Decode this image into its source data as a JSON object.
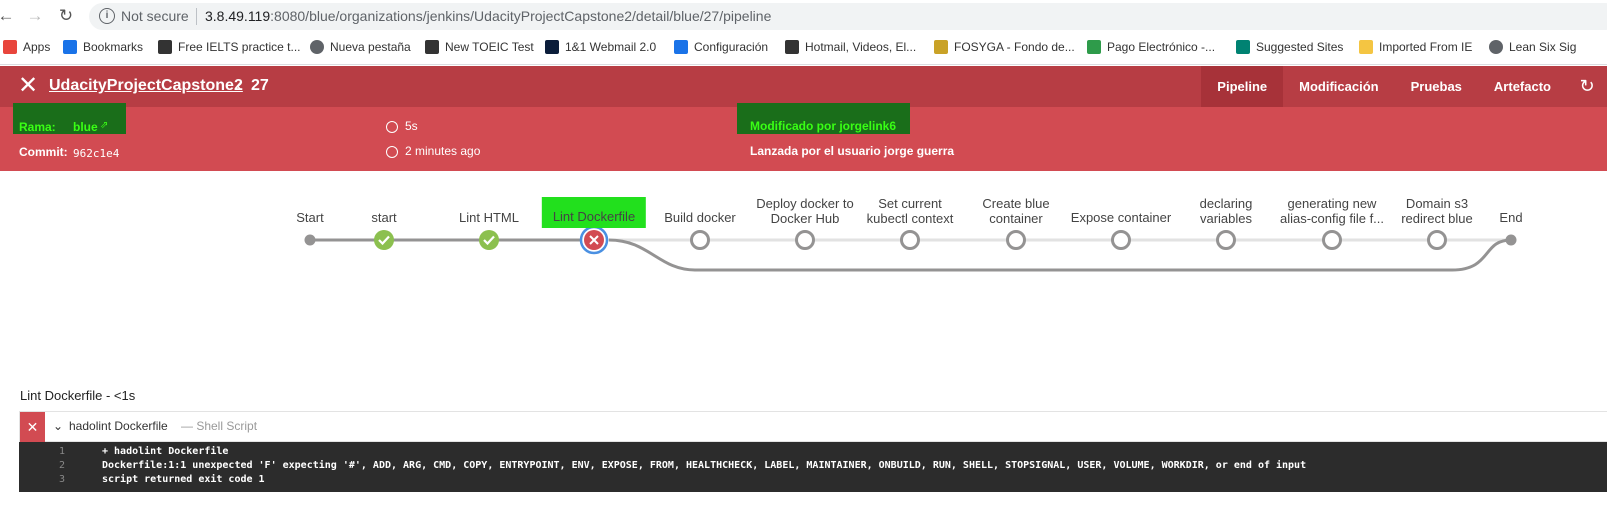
{
  "browser": {
    "not_secure": "Not secure",
    "url_host": "3.8.49.119",
    "url_rest": ":8080/blue/organizations/jenkins/UdacityProjectCapstone2/detail/blue/27/pipeline",
    "bookmarks": [
      {
        "label": "Apps",
        "icon": "apps-grid-icon",
        "color": "#e8453c"
      },
      {
        "label": "Bookmarks",
        "icon": "star-icon",
        "color": "#1a73e8"
      },
      {
        "label": "Free IELTS practice t...",
        "icon": "ielts-icon",
        "color": "#333333"
      },
      {
        "label": "Nueva pestaña",
        "icon": "globe-icon",
        "color": "#5f6368"
      },
      {
        "label": "New TOEIC Test",
        "icon": "toeic-icon",
        "color": "#333333"
      },
      {
        "label": "1&1 Webmail 2.0",
        "icon": "webmail-icon",
        "color": "#0b1d3a"
      },
      {
        "label": "Configuración",
        "icon": "gear-icon",
        "color": "#1a73e8"
      },
      {
        "label": "Hotmail, Videos, El...",
        "icon": "yahoo-icon",
        "color": "#333333"
      },
      {
        "label": "FOSYGA - Fondo de...",
        "icon": "fosyga-icon",
        "color": "#c9a227"
      },
      {
        "label": "Pago Electrónico -...",
        "icon": "pago-icon",
        "color": "#2e9b4a"
      },
      {
        "label": "Suggested Sites",
        "icon": "bing-icon",
        "color": "#008272"
      },
      {
        "label": "Imported From IE",
        "icon": "folder-icon",
        "color": "#f4c542"
      },
      {
        "label": "Lean Six Sig",
        "icon": "globe-icon",
        "color": "#5f6368"
      }
    ]
  },
  "header": {
    "project": "UdacityProjectCapstone2",
    "run_number": "27",
    "tabs": [
      "Pipeline",
      "Modificación",
      "Pruebas",
      "Artefacto"
    ],
    "active_tab": "Pipeline"
  },
  "summary": {
    "branch_label": "Rama:",
    "branch_value": "blue",
    "commit_label": "Commit:",
    "commit_value": "962c1e4",
    "duration": "5s",
    "time_ago": "2 minutes ago",
    "modified_by": "Modificado por jorgelink6",
    "launched_by": "Lanzada por el usuario jorge guerra"
  },
  "pipeline": {
    "stages": [
      {
        "label": "Start",
        "status": "endpoint"
      },
      {
        "label": "start",
        "status": "success"
      },
      {
        "label": "Lint HTML",
        "status": "success"
      },
      {
        "label": "Lint Dockerfile",
        "status": "failed"
      },
      {
        "label": "Build docker",
        "status": "not_run"
      },
      {
        "label": "Deploy docker to|Docker Hub",
        "status": "not_run"
      },
      {
        "label": "Set current|kubectl context",
        "status": "not_run"
      },
      {
        "label": "Create blue|container",
        "status": "not_run"
      },
      {
        "label": "Expose container",
        "status": "not_run"
      },
      {
        "label": "declaring|variables",
        "status": "not_run"
      },
      {
        "label": "generating new|alias-config file f...",
        "status": "not_run"
      },
      {
        "label": "Domain s3|redirect blue",
        "status": "not_run"
      },
      {
        "label": "End",
        "status": "endpoint"
      }
    ],
    "colors": {
      "success": "#8cc04f",
      "failed": "#d24b52",
      "selected_ring": "#4a90e2",
      "not_run": "#949393"
    }
  },
  "log": {
    "title": "Lint Dockerfile - <1s",
    "step_name": "hadolint Dockerfile",
    "step_type": "— Shell Script",
    "lines": [
      {
        "n": "1",
        "text": "+ hadolint Dockerfile"
      },
      {
        "n": "2",
        "text": "Dockerfile:1:1 unexpected 'F' expecting '#', ADD, ARG, CMD, COPY, ENTRYPOINT, ENV, EXPOSE, FROM, HEALTHCHECK, LABEL, MAINTAINER, ONBUILD, RUN, SHELL, STOPSIGNAL, USER, VOLUME, WORKDIR, or end of input"
      },
      {
        "n": "3",
        "text": "script returned exit code 1"
      }
    ]
  }
}
